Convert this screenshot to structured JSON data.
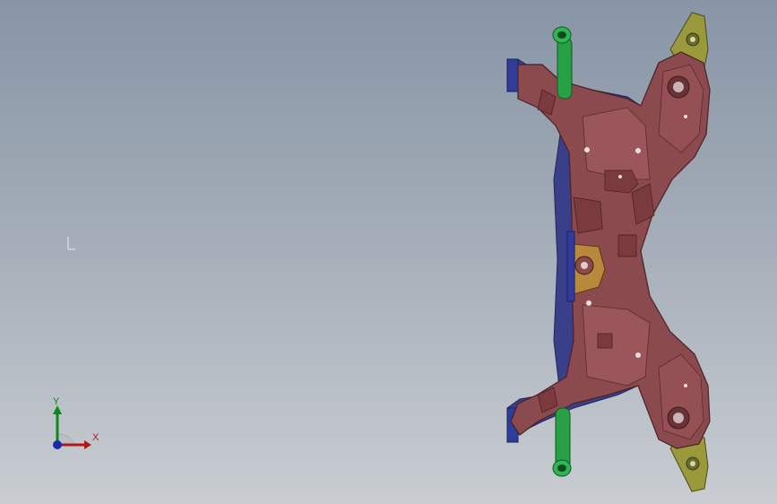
{
  "viewport": {
    "background_top": "#8795a6",
    "background_bottom": "#c9cdd2"
  },
  "part": {
    "body_color": "#8a4a4e",
    "edge_color": "#4a2226",
    "flange_color": "#3a3f8a",
    "bracket_color": "#9a9a3c",
    "bushing_color": "#27a046",
    "mount_color": "#b8893a"
  },
  "triad": {
    "x_label": "X",
    "y_label": "Y",
    "x_color": "#b01818",
    "y_color": "#0a8a1a",
    "z_color": "#1c2aa8"
  }
}
